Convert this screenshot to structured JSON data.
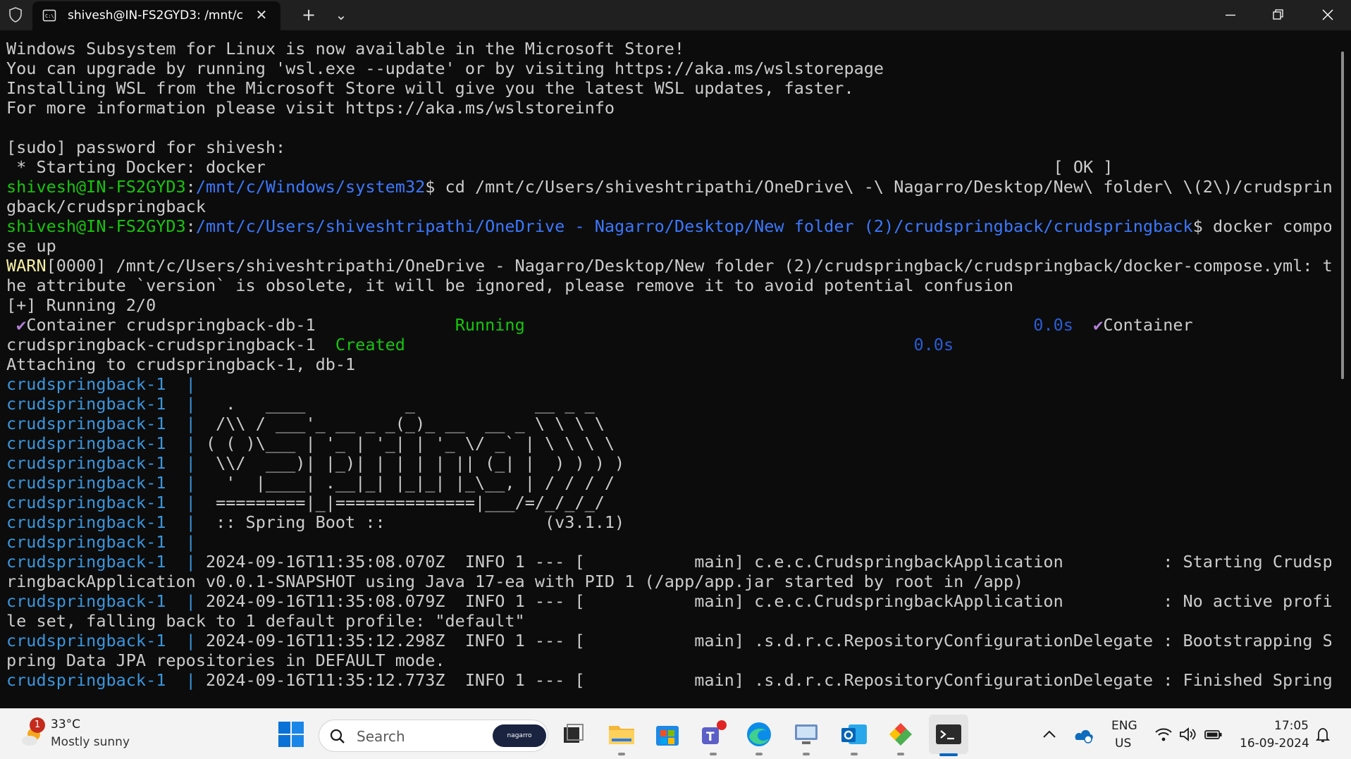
{
  "window": {
    "tab_title": "shivesh@IN-FS2GYD3: /mnt/c",
    "new_tab_symbol": "+",
    "dropdown_symbol": "⌄",
    "close_tab_symbol": "✕"
  },
  "terminal": {
    "lines": [
      [
        {
          "t": "Windows Subsystem for Linux is now available in the Microsoft Store!",
          "c": "w"
        }
      ],
      [
        {
          "t": "You can upgrade by running 'wsl.exe --update' or by visiting https://aka.ms/wslstorepage",
          "c": "w"
        }
      ],
      [
        {
          "t": "Installing WSL from the Microsoft Store will give you the latest WSL updates, faster.",
          "c": "w"
        }
      ],
      [
        {
          "t": "For more information please visit https://aka.ms/wslstoreinfo",
          "c": "w"
        }
      ],
      [
        {
          "t": "",
          "c": "w"
        }
      ],
      [
        {
          "t": "[sudo] password for shivesh:",
          "c": "w"
        }
      ],
      [
        {
          "t": " * Starting Docker: docker                                                                               [ OK ]",
          "c": "w"
        }
      ],
      [
        {
          "t": "shivesh@IN-FS2GYD3",
          "c": "g"
        },
        {
          "t": ":",
          "c": "w"
        },
        {
          "t": "/mnt/c/Windows/system32",
          "c": "b"
        },
        {
          "t": "$ cd /mnt/c/Users/shiveshtripathi/OneDrive\\ -\\ Nagarro/Desktop/New\\ folder\\ \\(2\\)/crudsprin",
          "c": "w"
        }
      ],
      [
        {
          "t": "gback/crudspringback",
          "c": "w"
        }
      ],
      [
        {
          "t": "shivesh@IN-FS2GYD3",
          "c": "g"
        },
        {
          "t": ":",
          "c": "w"
        },
        {
          "t": "/mnt/c/Users/shiveshtripathi/OneDrive - Nagarro/Desktop/New folder (2)/crudspringback/crudspringback",
          "c": "b"
        },
        {
          "t": "$ docker compo",
          "c": "w"
        }
      ],
      [
        {
          "t": "se up",
          "c": "w"
        }
      ],
      [
        {
          "t": "WARN",
          "c": "y"
        },
        {
          "t": "[0000] /mnt/c/Users/shiveshtripathi/OneDrive - Nagarro/Desktop/New folder (2)/crudspringback/crudspringback/docker-compose.yml: t",
          "c": "w"
        }
      ],
      [
        {
          "t": "he attribute `version` is obsolete, it will be ignored, please remove it to avoid potential confusion",
          "c": "w"
        }
      ],
      [
        {
          "t": "[+] Running 2/0",
          "c": "w"
        }
      ],
      [
        {
          "t": " ",
          "c": "w"
        },
        {
          "t": "✔",
          "c": "ck"
        },
        {
          "t": "Container crudspringback-db-1              ",
          "c": "w"
        },
        {
          "t": "Running",
          "c": "g"
        },
        {
          "t": "                                                   ",
          "c": "w"
        },
        {
          "t": "0.0s",
          "c": "bb"
        },
        {
          "t": "  ",
          "c": "w"
        },
        {
          "t": "✔",
          "c": "ck"
        },
        {
          "t": "Container",
          "c": "w"
        }
      ],
      [
        {
          "t": "crudspringback-crudspringback-1  ",
          "c": "w"
        },
        {
          "t": "Created",
          "c": "g"
        },
        {
          "t": "                                                   ",
          "c": "w"
        },
        {
          "t": "0.0s",
          "c": "bb"
        }
      ],
      [
        {
          "t": "Attaching to crudspringback-1, db-1",
          "c": "w"
        }
      ],
      [
        {
          "t": "crudspringback-1  | ",
          "c": "lb"
        }
      ],
      [
        {
          "t": "crudspringback-1  | ",
          "c": "lb"
        },
        {
          "t": "  .   ____          _            __ _ _",
          "c": "w"
        }
      ],
      [
        {
          "t": "crudspringback-1  | ",
          "c": "lb"
        },
        {
          "t": " /\\\\ / ___'_ __ _ _(_)_ __  __ _ \\ \\ \\ \\",
          "c": "w"
        }
      ],
      [
        {
          "t": "crudspringback-1  | ",
          "c": "lb"
        },
        {
          "t": "( ( )\\___ | '_ | '_| | '_ \\/ _` | \\ \\ \\ \\",
          "c": "w"
        }
      ],
      [
        {
          "t": "crudspringback-1  | ",
          "c": "lb"
        },
        {
          "t": " \\\\/  ___)| |_)| | | | | || (_| |  ) ) ) )",
          "c": "w"
        }
      ],
      [
        {
          "t": "crudspringback-1  | ",
          "c": "lb"
        },
        {
          "t": "  '  |____| .__|_| |_|_| |_\\__, | / / / /",
          "c": "w"
        }
      ],
      [
        {
          "t": "crudspringback-1  | ",
          "c": "lb"
        },
        {
          "t": " =========|_|==============|___/=/_/_/_/",
          "c": "w"
        }
      ],
      [
        {
          "t": "crudspringback-1  | ",
          "c": "lb"
        },
        {
          "t": " :: Spring Boot ::                (v3.1.1)",
          "c": "w"
        }
      ],
      [
        {
          "t": "crudspringback-1  | ",
          "c": "lb"
        }
      ],
      [
        {
          "t": "crudspringback-1  | ",
          "c": "lb"
        },
        {
          "t": "2024-09-16T11:35:08.070Z  INFO 1 --- [           main] c.e.c.CrudspringbackApplication          : Starting Crudsp",
          "c": "w"
        }
      ],
      [
        {
          "t": "ringbackApplication v0.0.1-SNAPSHOT using Java 17-ea with PID 1 (/app/app.jar started by root in /app)",
          "c": "w"
        }
      ],
      [
        {
          "t": "crudspringback-1  | ",
          "c": "lb"
        },
        {
          "t": "2024-09-16T11:35:08.079Z  INFO 1 --- [           main] c.e.c.CrudspringbackApplication          : No active profi",
          "c": "w"
        }
      ],
      [
        {
          "t": "le set, falling back to 1 default profile: \"default\"",
          "c": "w"
        }
      ],
      [
        {
          "t": "crudspringback-1  | ",
          "c": "lb"
        },
        {
          "t": "2024-09-16T11:35:12.298Z  INFO 1 --- [           main] .s.d.r.c.RepositoryConfigurationDelegate : Bootstrapping S",
          "c": "w"
        }
      ],
      [
        {
          "t": "pring Data JPA repositories in DEFAULT mode.",
          "c": "w"
        }
      ],
      [
        {
          "t": "crudspringback-1  | ",
          "c": "lb"
        },
        {
          "t": "2024-09-16T11:35:12.773Z  INFO 1 --- [           main] .s.d.r.c.RepositoryConfigurationDelegate : Finished Spring",
          "c": "w"
        }
      ]
    ]
  },
  "taskbar": {
    "weather_badge": "1",
    "temperature": "33°C",
    "condition": "Mostly sunny",
    "search_placeholder": "Search",
    "search_pill": "nagarro",
    "language": "ENG",
    "region": "US",
    "time": "17:05",
    "date": "16-09-2024"
  }
}
